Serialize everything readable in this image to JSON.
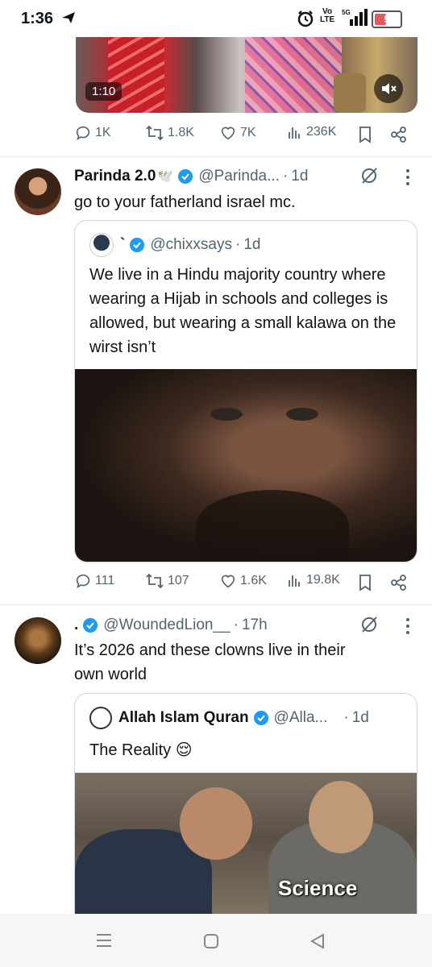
{
  "status_bar": {
    "time": "1:36",
    "volte_top": "Vo",
    "volte_bottom": "LTE",
    "network": "5G",
    "battery": "9",
    "icons": [
      "telegram-send-icon",
      "alarm-icon",
      "signal-icon",
      "battery-icon"
    ]
  },
  "top_post": {
    "video_time": "1:10",
    "actions": {
      "replies": "1K",
      "reposts": "1.8K",
      "likes": "7K",
      "views": "236K"
    }
  },
  "tweets": [
    {
      "name": "Parinda 2.0",
      "handle": "@Parinda...",
      "time": "1d",
      "text": "go to your fatherland israel mc.",
      "quote": {
        "name": "`",
        "handle": "@chixxsays",
        "time": "1d",
        "text": "We live in a Hindu majority country where wearing a Hijab in schools and colleges is allowed, but wearing a small kalawa on the wirst isn’t"
      },
      "actions": {
        "replies": "111",
        "reposts": "107",
        "likes": "1.6K",
        "views": "19.8K"
      }
    },
    {
      "name": ".",
      "handle": "@WoundedLion__",
      "time": "17h",
      "text_line1": "It’s 2026 and these clowns live in their",
      "text_line2": "own world",
      "quote": {
        "name": "Allah Islam Quran",
        "handle": "@Alla...",
        "time": "1d",
        "text": "The Reality 😌",
        "image_caption": "Science"
      }
    }
  ],
  "colors": {
    "verified": "#1d9bf0",
    "muted": "#536471",
    "border": "#cfd9de"
  }
}
